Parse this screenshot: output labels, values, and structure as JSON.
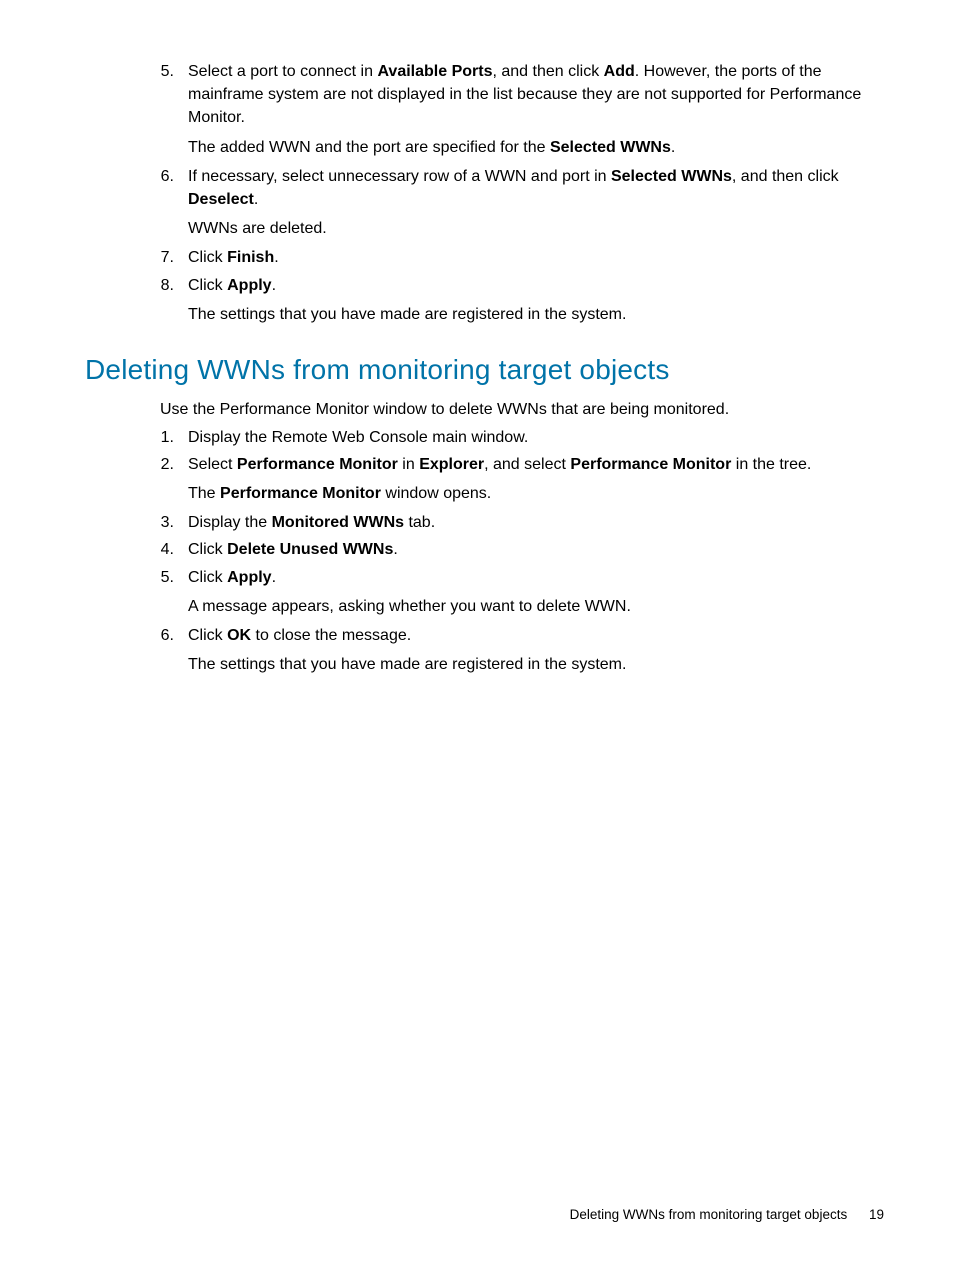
{
  "section1": {
    "steps": [
      {
        "num": "5.",
        "runs": [
          {
            "t": "Select a port to connect in "
          },
          {
            "t": "Available Ports",
            "b": true
          },
          {
            "t": ", and then click "
          },
          {
            "t": "Add",
            "b": true
          },
          {
            "t": ". However, the ports of the mainframe system are not displayed in the list because they are not supported for Performance Monitor."
          }
        ],
        "sub": [
          {
            "t": "The added WWN and the port are specified for the "
          },
          {
            "t": "Selected WWNs",
            "b": true
          },
          {
            "t": "."
          }
        ]
      },
      {
        "num": "6.",
        "runs": [
          {
            "t": "If necessary, select unnecessary row of a WWN and port in "
          },
          {
            "t": "Selected WWNs",
            "b": true
          },
          {
            "t": ", and then click "
          },
          {
            "t": "Deselect",
            "b": true
          },
          {
            "t": "."
          }
        ],
        "sub": [
          {
            "t": "WWNs are deleted."
          }
        ]
      },
      {
        "num": "7.",
        "runs": [
          {
            "t": "Click "
          },
          {
            "t": "Finish",
            "b": true
          },
          {
            "t": "."
          }
        ]
      },
      {
        "num": "8.",
        "runs": [
          {
            "t": "Click "
          },
          {
            "t": "Apply",
            "b": true
          },
          {
            "t": "."
          }
        ],
        "sub": [
          {
            "t": "The settings that you have made are registered in the system."
          }
        ]
      }
    ]
  },
  "heading": "Deleting WWNs from monitoring target objects",
  "intro": "Use the Performance Monitor window to delete WWNs that are being monitored.",
  "section2": {
    "steps": [
      {
        "num": "1.",
        "runs": [
          {
            "t": "Display the Remote Web Console main window."
          }
        ]
      },
      {
        "num": "2.",
        "runs": [
          {
            "t": "Select "
          },
          {
            "t": "Performance Monitor",
            "b": true
          },
          {
            "t": " in "
          },
          {
            "t": "Explorer",
            "b": true
          },
          {
            "t": ", and select "
          },
          {
            "t": "Performance Monitor",
            "b": true
          },
          {
            "t": " in the tree."
          }
        ],
        "sub": [
          {
            "t": "The "
          },
          {
            "t": "Performance Monitor",
            "b": true
          },
          {
            "t": " window opens."
          }
        ]
      },
      {
        "num": "3.",
        "runs": [
          {
            "t": "Display the "
          },
          {
            "t": "Monitored WWNs",
            "b": true
          },
          {
            "t": " tab."
          }
        ]
      },
      {
        "num": "4.",
        "runs": [
          {
            "t": "Click "
          },
          {
            "t": "Delete Unused WWNs",
            "b": true
          },
          {
            "t": "."
          }
        ]
      },
      {
        "num": "5.",
        "runs": [
          {
            "t": "Click "
          },
          {
            "t": "Apply",
            "b": true
          },
          {
            "t": "."
          }
        ],
        "sub": [
          {
            "t": "A message appears, asking whether you want to delete WWN."
          }
        ]
      },
      {
        "num": "6.",
        "runs": [
          {
            "t": "Click "
          },
          {
            "t": "OK",
            "b": true
          },
          {
            "t": " to close the message."
          }
        ],
        "sub": [
          {
            "t": "The settings that you have made are registered in the system."
          }
        ]
      }
    ]
  },
  "footer": {
    "title": "Deleting WWNs from monitoring target objects",
    "page": "19"
  }
}
